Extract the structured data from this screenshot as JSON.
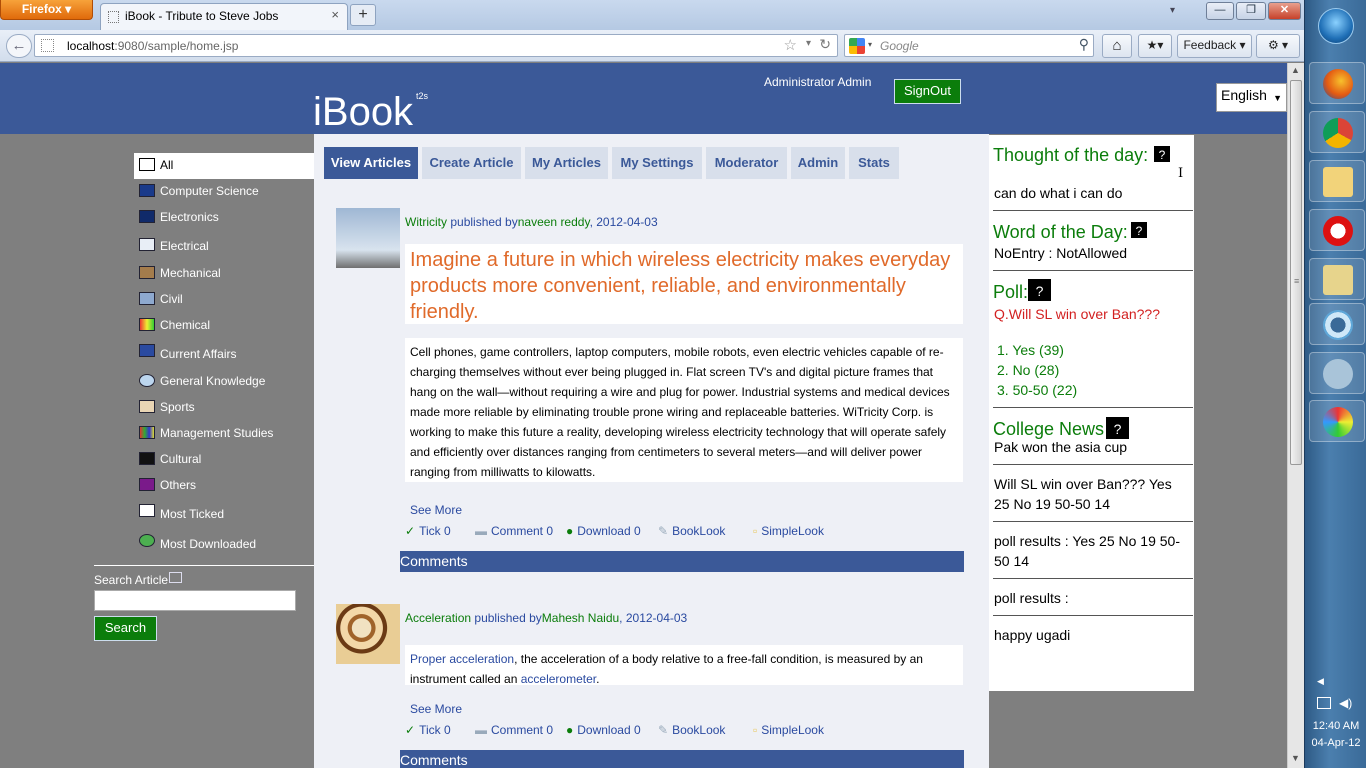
{
  "browser": {
    "app_button": "Firefox",
    "tab_title": "iBook - Tribute to Steve Jobs",
    "url_host": "localhost",
    "url_rest": ":9080/sample/home.jsp",
    "search_placeholder": "Google",
    "feedback_label": "Feedback"
  },
  "header": {
    "logo": "iBook",
    "logo_sup": "t2s",
    "user_name": "Administrator Admin",
    "signout_label": "SignOut",
    "language": "English"
  },
  "sidebar": {
    "categories": [
      {
        "label": "All",
        "icon": "all-icon"
      },
      {
        "label": "Computer Science",
        "icon": "computer-icon"
      },
      {
        "label": "Electronics",
        "icon": "chip-icon"
      },
      {
        "label": "Electrical",
        "icon": "electrical-icon"
      },
      {
        "label": "Mechanical",
        "icon": "gear-icon"
      },
      {
        "label": "Civil",
        "icon": "building-icon"
      },
      {
        "label": "Chemical",
        "icon": "flask-icon"
      },
      {
        "label": "Current Affairs",
        "icon": "news-icon"
      },
      {
        "label": "General Knowledge",
        "icon": "globe-icon"
      },
      {
        "label": "Sports",
        "icon": "ball-icon"
      },
      {
        "label": "Management Studies",
        "icon": "chart-icon"
      },
      {
        "label": "Cultural",
        "icon": "masks-icon"
      },
      {
        "label": "Others",
        "icon": "misc-icon"
      },
      {
        "label": "Most Ticked",
        "icon": "tick-icon"
      },
      {
        "label": "Most Downloaded",
        "icon": "download-icon"
      }
    ],
    "search_label": "Search Article",
    "search_button": "Search"
  },
  "tabs": [
    {
      "label": "View Articles",
      "active": true
    },
    {
      "label": "Create Article"
    },
    {
      "label": "My Articles"
    },
    {
      "label": "My Settings"
    },
    {
      "label": "Moderator"
    },
    {
      "label": "Admin"
    },
    {
      "label": "Stats"
    }
  ],
  "articles": [
    {
      "title": "Witricity",
      "published_by": "published by",
      "author": "naveen reddy",
      "date": ", 2012-04-03",
      "headline": "Imagine a future in which wireless electricity makes everyday products more convenient, reliable, and environmentally friendly.",
      "body": "Cell phones, game controllers, laptop computers, mobile robots, even electric vehicles capable of re-charging themselves without ever being plugged in. Flat screen TV's and digital picture frames that hang on the wall—without requiring a wire and plug for power. Industrial systems and medical devices made more reliable by eliminating trouble prone wiring and replaceable batteries. WiTricity Corp. is working to make this future a reality, developing wireless electricity technology that will operate safely and efficiently over distances ranging from centimeters to several meters—and will deliver power ranging from milliwatts to kilowatts.",
      "see_more": "See More",
      "tick": "Tick 0",
      "comment": "Comment 0",
      "download": "Download 0",
      "booklook": "BookLook",
      "simplelook": "SimpleLook",
      "comments_bar": "Comments"
    },
    {
      "title": "Acceleration",
      "published_by": "published by",
      "author": "Mahesh Naidu",
      "date": ", 2012-04-03",
      "body_link1": "Proper acceleration",
      "body_mid": ", the acceleration of a body relative to a free-fall condition, is measured by an instrument called an ",
      "body_link2": "accelerometer",
      "body_end": ".",
      "see_more": "See More",
      "tick": "Tick 0",
      "comment": "Comment 0",
      "download": "Download 0",
      "booklook": "BookLook",
      "simplelook": "SimpleLook",
      "comments_bar": "Comments"
    }
  ],
  "rightpanel": {
    "thought_title": "Thought of the day:",
    "thought_text": "can do what i can do",
    "word_title": "Word of the Day:",
    "word_text": "NoEntry : NotAllowed",
    "poll_title": "Poll:",
    "poll_question": "Q.Will SL win over Ban???",
    "poll_options": [
      "1. Yes (39)",
      "2. No (28)",
      "3. 50-50 (22)"
    ],
    "news_title": "College News:",
    "news_items": [
      "Pak won the asia cup",
      "Will SL win over Ban??? Yes 25 No 19 50-50 14",
      "poll results : Yes 25 No 19 50-50 14",
      "poll results :",
      "happy ugadi"
    ],
    "help_glyph": "?"
  },
  "taskbar": {
    "time": "12:40 AM",
    "date": "04-Apr-12"
  },
  "colors": {
    "brand_blue": "#3b5998",
    "green": "#0b7d0b",
    "headline_orange": "#e06a2a",
    "poll_red": "#d21f1f"
  }
}
